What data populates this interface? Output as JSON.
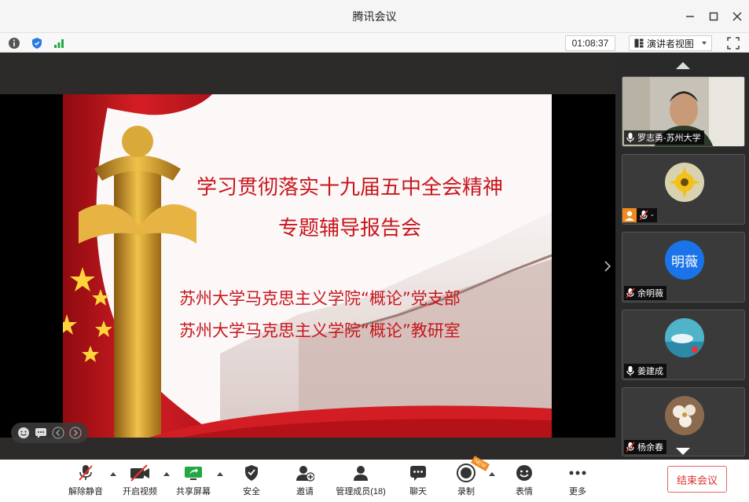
{
  "window": {
    "title": "腾讯会议"
  },
  "infobar": {
    "timer": "01:08:37",
    "view_mode": "演讲者视图"
  },
  "slide": {
    "line1": "学习贯彻落实十九届五中全会精神",
    "line2": "专题辅导报告会",
    "line3": "苏州大学马克思主义学院“概论”党支部",
    "line4": "苏州大学马克思主义学院“概论”教研室"
  },
  "participants": [
    {
      "name": "罗志勇-苏州大学",
      "avatar_text": "",
      "mic": "on"
    },
    {
      "name": "-",
      "avatar_text": "",
      "mic": "muted"
    },
    {
      "name": "余明薇",
      "avatar_text": "明薇",
      "mic": "muted",
      "avatar_color": "#1a73e8"
    },
    {
      "name": "姜建成",
      "avatar_text": "",
      "mic": "on"
    },
    {
      "name": "杨余春",
      "avatar_text": "",
      "mic": "muted"
    }
  ],
  "toolbar": {
    "mute": "解除静音",
    "video": "开启视频",
    "share": "共享屏幕",
    "security": "安全",
    "invite": "邀请",
    "members": "管理成员(18)",
    "chat": "聊天",
    "record": "录制",
    "record_badge": "NEW",
    "reactions": "表情",
    "more": "更多",
    "end": "结束会议"
  },
  "colors": {
    "accent_red": "#c8161d",
    "end_red": "#e0302f",
    "panel_bg": "#2a2a2a"
  }
}
